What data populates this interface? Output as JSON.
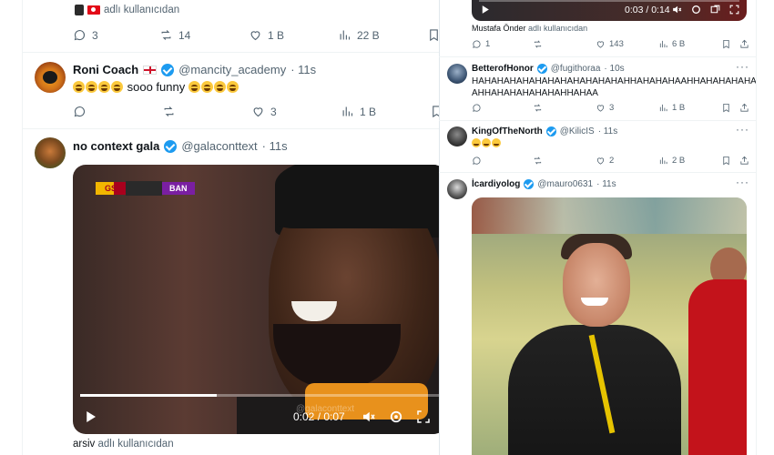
{
  "left": {
    "top_attribution": "adlı kullanıcıdan",
    "first_actions": {
      "replies": "3",
      "retweets": "14",
      "likes": "1 B",
      "views": "22 B"
    },
    "tweet2": {
      "name": "Roni Coach",
      "handle": "@mancity_academy",
      "time": "· 11s",
      "text_mid": "sooo funny",
      "actions": {
        "likes": "3",
        "views": "1 B"
      }
    },
    "tweet3": {
      "name": "no context gala",
      "handle": "@galaconttext",
      "time": "· 11s",
      "video": {
        "team_home": "GS",
        "team_away": "BAN",
        "time": "0:02 / 0:07",
        "progress": 0.38,
        "watermark": "@galaconttext"
      },
      "attribution_user": "arsiv",
      "attribution_suffix": "adlı kullanıcıdan"
    }
  },
  "right": {
    "top_video": {
      "time": "0:03 / 0:14"
    },
    "top_attribution_user": "Mustafa Önder",
    "top_attribution_suffix": "adlı kullanıcıdan",
    "top_actions": {
      "replies": "1",
      "likes": "143",
      "views": "6 B"
    },
    "reply1": {
      "name": "BetterofHonor",
      "handle": "@fugithoraa",
      "time": "· 10s",
      "text_line1": "HAHAHAHAHAHAHAHAHAHAHAHAHHAHAHAHAAHHAHAHAHAHAHAH",
      "text_line2": "AHHAHAHAHAHAHAHHAHAA",
      "actions": {
        "likes": "3",
        "views": "1 B"
      }
    },
    "reply2": {
      "name": "KingOfTheNorth",
      "handle": "@KilicIS",
      "time": "· 11s",
      "actions": {
        "likes": "2",
        "views": "2 B"
      }
    },
    "reply3": {
      "name": "İcardiyolog",
      "handle": "@mauro0631",
      "time": "· 11s"
    }
  },
  "icons": [
    "reply-icon",
    "retweet-icon",
    "heart-icon",
    "views-icon",
    "bookmark-icon",
    "share-icon",
    "play-icon",
    "volume-icon",
    "settings-icon",
    "fullscreen-icon",
    "verified-icon"
  ]
}
